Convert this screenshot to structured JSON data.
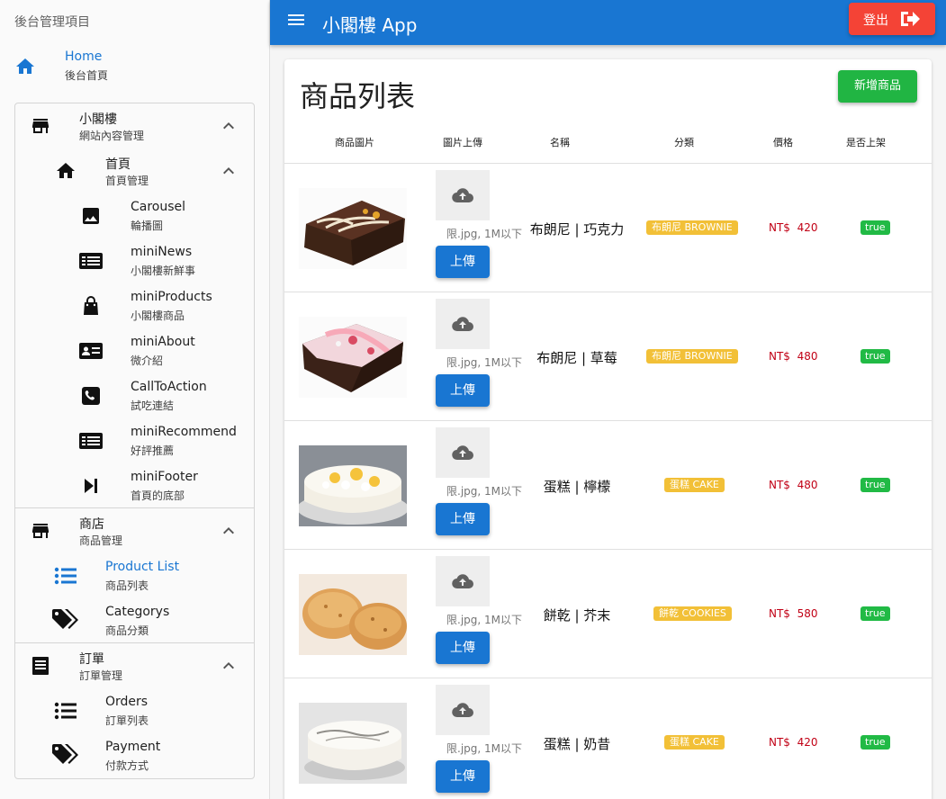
{
  "sidebar": {
    "title": "後台管理項目",
    "home": {
      "label": "Home",
      "sub": "後台首頁"
    },
    "groups": [
      {
        "label": "小閣樓",
        "sub": "網站內容管理",
        "subgroup": {
          "label": "首頁",
          "sub": "首頁管理",
          "items": [
            {
              "label": "Carousel",
              "sub": "輪播圖"
            },
            {
              "label": "miniNews",
              "sub": "小閣樓新鮮事"
            },
            {
              "label": "miniProducts",
              "sub": "小閣樓商品"
            },
            {
              "label": "miniAbout",
              "sub": "微介紹"
            },
            {
              "label": "CallToAction",
              "sub": "試吃連結"
            },
            {
              "label": "miniRecommend",
              "sub": "好評推薦"
            },
            {
              "label": "miniFooter",
              "sub": "首頁的底部"
            }
          ]
        }
      },
      {
        "label": "商店",
        "sub": "商品管理",
        "items": [
          {
            "label": "Product List",
            "sub": "商品列表"
          },
          {
            "label": "Categorys",
            "sub": "商品分類"
          }
        ]
      },
      {
        "label": "訂單",
        "sub": "訂單管理",
        "items": [
          {
            "label": "Orders",
            "sub": "訂單列表"
          },
          {
            "label": "Payment",
            "sub": "付款方式"
          }
        ]
      }
    ]
  },
  "appbar": {
    "title": "小閣樓 App",
    "logout_label": "登出"
  },
  "main": {
    "page_title": "商品列表",
    "add_button": "新增商品",
    "columns": [
      "商品圖片",
      "圖片上傳",
      "名稱",
      "分類",
      "價格",
      "是否上架"
    ],
    "upload_hint": "限.jpg, 1M以下",
    "upload_button": "上傳",
    "products": [
      {
        "name": "布朗尼 | 巧克力",
        "category": "布朗尼 BROWNIE",
        "currency": "NT$",
        "price": "420",
        "status": "true",
        "image": "chocolate-brownie-photo"
      },
      {
        "name": "布朗尼 | 草莓",
        "category": "布朗尼 BROWNIE",
        "currency": "NT$",
        "price": "480",
        "status": "true",
        "image": "strawberry-brownie-photo"
      },
      {
        "name": "蛋糕 | 檸檬",
        "category": "蛋糕 CAKE",
        "currency": "NT$",
        "price": "480",
        "status": "true",
        "image": "lemon-cake-photo"
      },
      {
        "name": "餅乾 | 芥末",
        "category": "餅乾 COOKIES",
        "currency": "NT$",
        "price": "580",
        "status": "true",
        "image": "wasabi-cookie-photo"
      },
      {
        "name": "蛋糕 | 奶昔",
        "category": "蛋糕 CAKE",
        "currency": "NT$",
        "price": "420",
        "status": "true",
        "image": "milkshake-cake-photo"
      }
    ]
  },
  "colors": {
    "primary": "#1976d2",
    "danger": "#f44336",
    "success": "#21b543",
    "warning": "#f2c037",
    "price": "#c10015"
  }
}
